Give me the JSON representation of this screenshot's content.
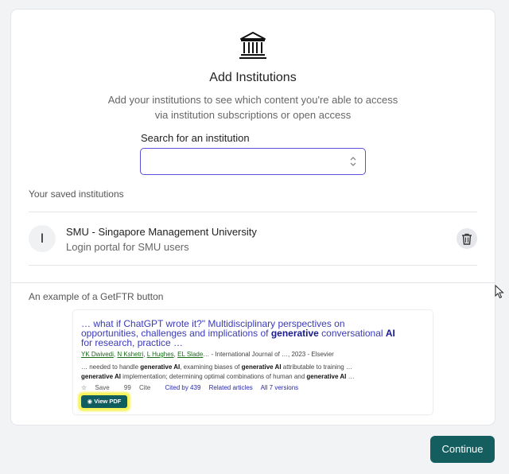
{
  "header": {
    "icon": "bank-building-icon",
    "title": "Add Institutions",
    "subtitle": "Add your institutions to see which content you're able to access via institution subscriptions or open access"
  },
  "search": {
    "label": "Search for an institution",
    "value": "",
    "placeholder": "",
    "stepper_icon": "up-down-chevron-icon"
  },
  "saved": {
    "heading": "Your saved institutions",
    "items": [
      {
        "avatar_letter": "I",
        "name": "SMU - Singapore Management University",
        "description": "Login portal for SMU users",
        "delete_icon": "trash-icon"
      }
    ]
  },
  "example": {
    "heading": "An example of a GetFTR button",
    "result": {
      "title_pre": "… what if ChatGPT wrote it?\" Multidisciplinary perspectives on opportunities, challenges and implications of ",
      "title_b1": "generative",
      "title_mid": " conversational ",
      "title_b2": "AI",
      "title_post": " for research, practice …",
      "authors": [
        "YK Dwivedi",
        "N Kshetri",
        "L Hughes",
        "EL Slade"
      ],
      "authors_tail": "… - International Journal of …, 2023 - Elsevier",
      "snippet_line1_pre": "… needed to handle ",
      "snippet_line1_b1": "generative AI",
      "snippet_line1_mid": ", examining biases of ",
      "snippet_line1_b2": "generative AI",
      "snippet_line1_post": " attributable to training …",
      "snippet_line2_b1": "generative AI",
      "snippet_line2_mid": " implementation; determining optimal combinations of human and ",
      "snippet_line2_b2": "generative AI",
      "snippet_line2_post": " …",
      "save": "Save",
      "cite": "Cite",
      "cited_by": "Cited by 439",
      "related": "Related articles",
      "versions": "All 7 versions",
      "pdf_button": "View PDF"
    }
  },
  "footer": {
    "continue_label": "Continue"
  },
  "colors": {
    "accent": "#145e60",
    "focus": "#5b4fe0",
    "highlight": "#f7f35a"
  }
}
